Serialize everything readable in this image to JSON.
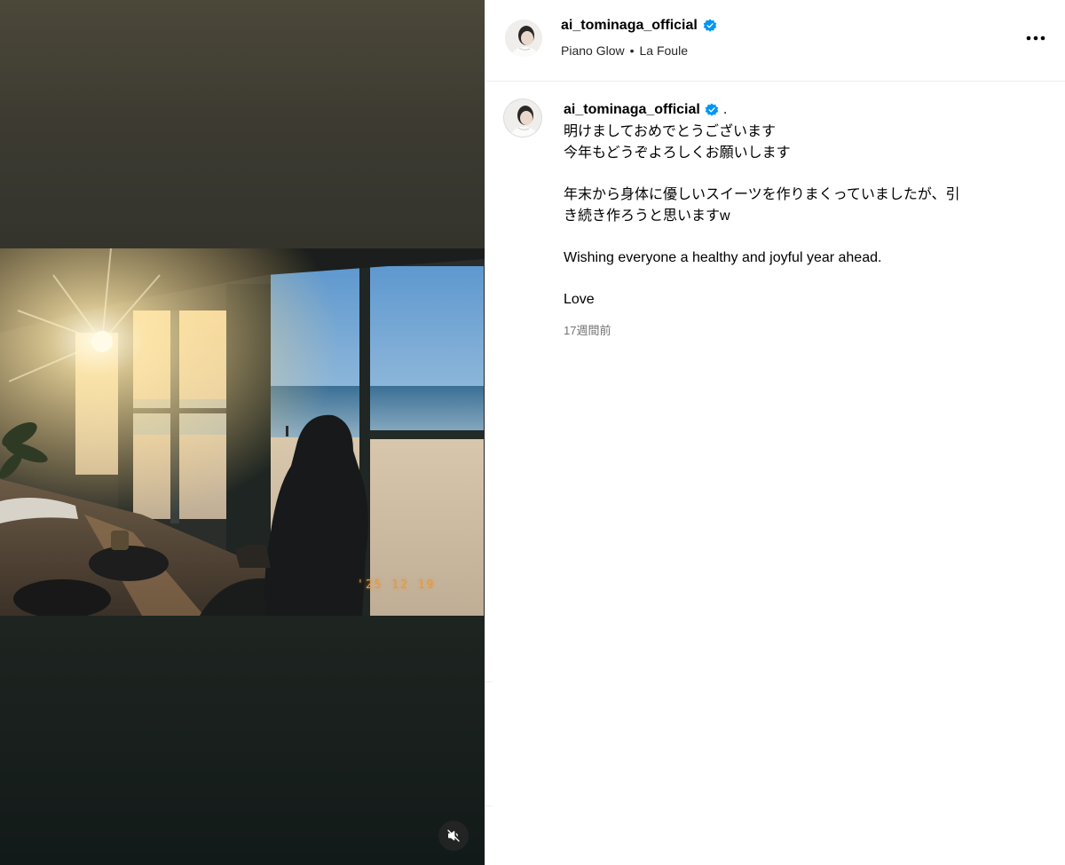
{
  "post": {
    "username": "ai_tominaga_official",
    "audio": {
      "track": "Piano Glow",
      "artist": "La Foule",
      "separator": "•"
    },
    "caption": {
      "lead": ".",
      "paragraphs": [
        "明けましておめでとうございます\n今年もどうぞよろしくお願いします",
        "年末から身体に優しいスイーツを作りまくっていましたが、引\nき続き作ろうと思いますw",
        "Wishing everyone a healthy and joyful year ahead.",
        "Love"
      ]
    },
    "time_ago": "17週間前",
    "photo_datestamp": "'25 12 19"
  },
  "icons": {
    "verified": "verified-badge-icon",
    "more": "more-options-icon",
    "mute": "muted-speaker-icon"
  },
  "colors": {
    "verified": "#0095f6",
    "secondary_text": "#737373",
    "divider": "#efefef",
    "datestamp": "#e39a3c"
  }
}
